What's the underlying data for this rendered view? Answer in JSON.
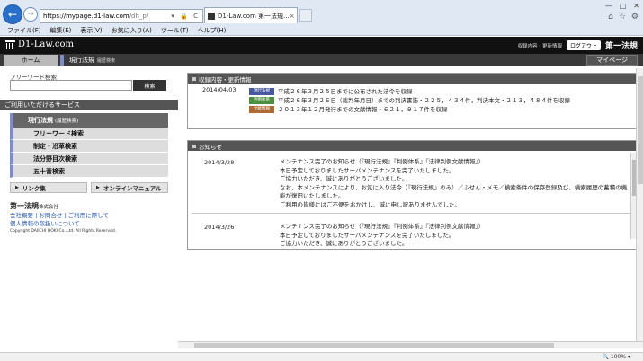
{
  "browser": {
    "address_host": "https://mypage.d1-law.com",
    "address_path": "/dh_p/",
    "address_icons": "▾ 🔒 C",
    "tab_title": "D1-Law.com 第一法規...",
    "menu": [
      "ファイル(F)",
      "編集(E)",
      "表示(V)",
      "お気に入り(A)",
      "ツール(T)",
      "ヘルプ(H)"
    ],
    "zoom": "100%"
  },
  "header": {
    "logo": "D1-Law.com",
    "update_link": "収録内容・更新情報",
    "logout": "ログアウト",
    "brand": "第一法規"
  },
  "subnav": {
    "home": "ホーム",
    "genko": "現行法規",
    "genko_sub": "履歴検索",
    "mypage": "マイページ"
  },
  "left": {
    "freeword_label": "フリーワード検索",
    "freeword_value": "",
    "search_button": "検索",
    "services_header": "ご利用いただけるサービス",
    "main_item": "現行法規",
    "main_item_sub": "(履歴検索)",
    "items": [
      "フリーワード検索",
      "制定・沿革検索",
      "法分野目次検索",
      "五十音検索"
    ],
    "links_button": "リンク集",
    "manual_button": "オンラインマニュアル",
    "company_name": "第一法規",
    "company_suffix": "株式会社",
    "company_links_1": "会社概要 | お問合せ | ご利用に際して",
    "company_links_2": "個人情報の取扱いについて",
    "copyright": "Copyright DAIICHI HOKI Co.,Ltd. All Rights Reserved."
  },
  "updates": {
    "title": "収録内容・更新情報",
    "date": "2014/04/03",
    "rows": [
      {
        "tag": "現行法規",
        "text": "平成２６年３月２５日までに公布された法令を収録"
      },
      {
        "tag": "判例体系",
        "text": "平成２６年３月２６日（裁判年月日）までの判決書誌・２２５，４３４件，判決本文・２１３，４８４件を収録"
      },
      {
        "tag": "文献情報",
        "text": "２０１３年１２月発行までの文献情報・６２１，９１７件を収録"
      }
    ]
  },
  "news": {
    "title": "お知らせ",
    "items": [
      {
        "date": "2014/3/28",
        "lines": [
          "メンテナンス完了のお知らせ（『現行法規』『判例体系』『法律判例文献情報』）",
          "本日予定しておりましたサーバメンテナンスを完了いたしました。",
          "ご協力いただき、誠にありがとうございました。",
          "なお、本メンテナンスにより、お気に入り法令（『現行法規』のみ）／ふせん・メモ／検索条件の保存登録及び、検索履歴の蓄積の機能が復旧いたしました。",
          "ご利用の皆様にはご不便をおかけし、誠に申し訳ありませんでした。"
        ]
      },
      {
        "date": "2014/3/26",
        "lines": [
          "メンテナンス完了のお知らせ（『現行法規』『判例体系』『法律判例文献情報』）",
          "本日予定しておりましたサーバメンテナンスを完了いたしました。",
          "ご協力いただき、誠にありがとうございました。"
        ]
      }
    ]
  }
}
